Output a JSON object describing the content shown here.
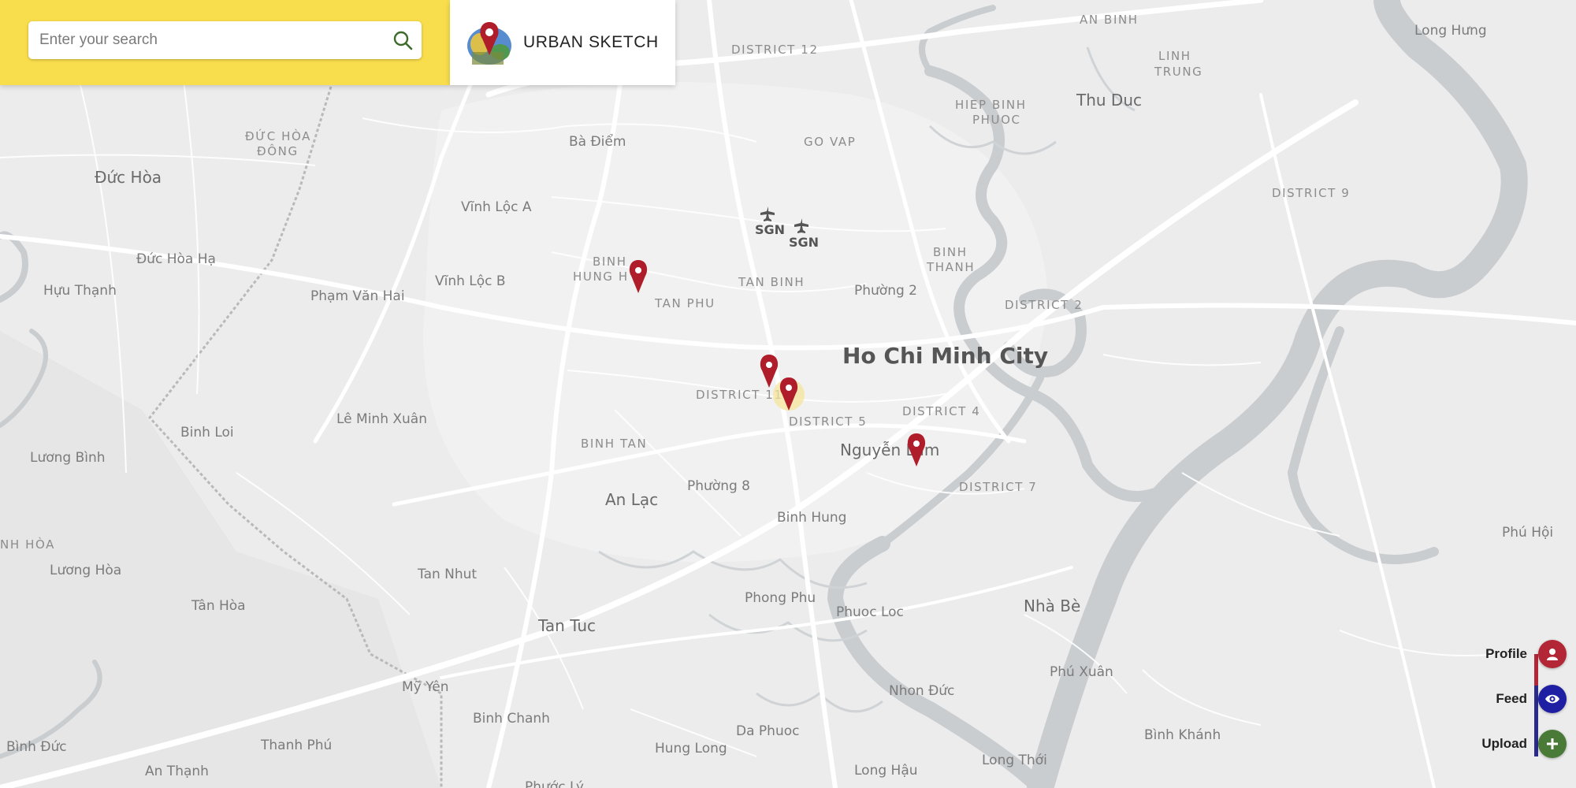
{
  "search": {
    "placeholder": "Enter your search",
    "icon": "search-icon"
  },
  "brand": {
    "name": "URBAN SKETCH",
    "logo_icon": "urban-sketch-pin-logo"
  },
  "map": {
    "city": "Ho Chi Minh City",
    "labels": {
      "an_binh": "AN BINH",
      "linh_trung_1": "LINH",
      "linh_trung_2": "TRUNG",
      "long_hung": "Long Hưng",
      "district_12": "DISTRICT 12",
      "hiep_binh_1": "HIEP BINH",
      "hiep_binh_2": "PHUOC",
      "thu_duc": "Thu Duc",
      "duc_hoa_dong_1": "ĐỨC HÒA",
      "duc_hoa_dong_2": "ĐÔNG",
      "ba_diem": "Bà Điểm",
      "go_vap": "GO VAP",
      "duc_hoa": "Đức Hòa",
      "district_9": "DISTRICT 9",
      "vinh_loc_a": "Vĩnh Lộc A",
      "sgn_1": "SGN",
      "sgn_2": "SGN",
      "binh_thanh_1": "BINH",
      "binh_thanh_2": "THANH",
      "duc_hoa_ha": "Đức Hòa Hạ",
      "binh_hung_hoa_1": "BINH",
      "binh_hung_hoa_2": "HUNG H",
      "tan_binh": "TAN BINH",
      "huu_thanh": "Hựu Thạnh",
      "pham_van_hai": "Phạm Văn Hai",
      "vinh_loc_b": "Vĩnh Lộc B",
      "tan_phu": "TAN PHU",
      "phuong_2": "Phường 2",
      "district_2": "DISTRICT 2",
      "district_11": "DISTRICT 11",
      "district_5": "DISTRICT 5",
      "district_4": "DISTRICT 4",
      "le_minh_xuan": "Lê Minh Xuân",
      "binh_loi": "Binh Loi",
      "binh_tan": "BINH TAN",
      "nguyen_lam": "Nguyễn Lâm",
      "luong_binh": "Lương Bình",
      "phuong_8": "Phường 8",
      "district_7": "DISTRICT 7",
      "an_lac": "An Lạc",
      "binh_hung": "Binh Hung",
      "phu_hoi": "Phú Hội",
      "nh_hoa": "NH HÒA",
      "luong_hoa": "Lương Hòa",
      "tan_nhut": "Tan Nhut",
      "tan_hoa": "Tân Hòa",
      "phong_phu": "Phong Phu",
      "phuoc_loc": "Phuoc Loc",
      "nha_be": "Nhà Bè",
      "tan_tuc": "Tan Tuc",
      "phu_xuan": "Phú Xuân",
      "my_yen": "Mỹ Yên",
      "nhon_duc": "Nhon Đức",
      "binh_chanh": "Binh Chanh",
      "da_phuoc": "Da Phuoc",
      "binh_khanh": "Bình Khánh",
      "binh_duc": "Bình Đức",
      "thanh_phu": "Thanh Phú",
      "hung_long": "Hung Long",
      "long_thoi": "Long Thới",
      "an_thanh": "An Thạnh",
      "long_hau": "Long Hậu",
      "phuoc_ly": "Phước Lý"
    },
    "markers_icon": "map-pin-icon"
  },
  "actions": [
    {
      "key": "profile",
      "label": "Profile",
      "icon": "user-icon",
      "color": "#b32636"
    },
    {
      "key": "feed",
      "label": "Feed",
      "icon": "eye-icon",
      "color": "#1f1fa3"
    },
    {
      "key": "upload",
      "label": "Upload",
      "icon": "plus-icon",
      "color": "#4a7a38"
    }
  ]
}
